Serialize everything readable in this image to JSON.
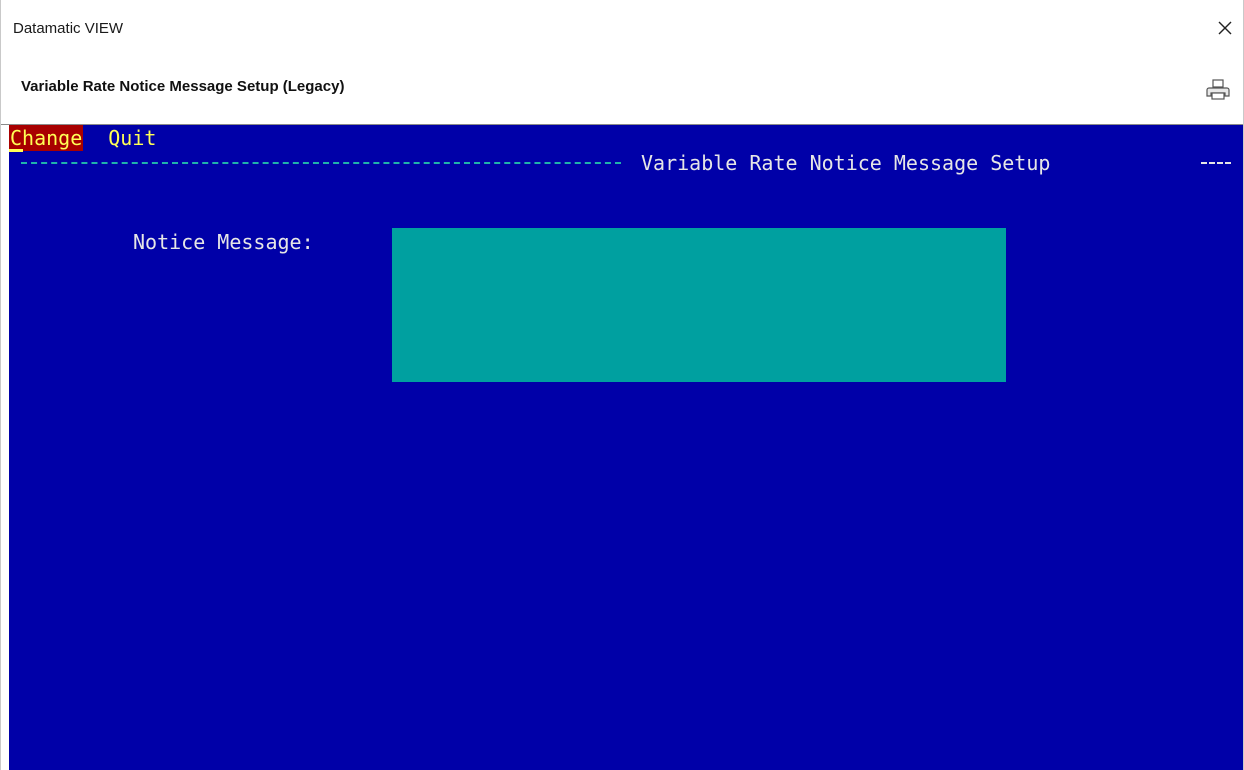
{
  "window": {
    "app_title": "Datamatic VIEW",
    "screen_title": "Variable Rate Notice Message Setup (Legacy)",
    "close_icon": "close-icon",
    "print_icon": "printer-icon"
  },
  "terminal": {
    "menu": [
      {
        "label": "Change",
        "active": true
      },
      {
        "label": "Quit",
        "active": false
      }
    ],
    "section_title": "Variable Rate Notice Message Setup",
    "field": {
      "label": "Notice Message:",
      "value": ""
    }
  },
  "colors": {
    "terminal_bg": "#0000a8",
    "menu_text": "#ffff55",
    "menu_active_bg": "#a80000",
    "field_bg": "#00a0a0",
    "rule_dash": "#20b2aa",
    "text": "#e6e6e6"
  }
}
